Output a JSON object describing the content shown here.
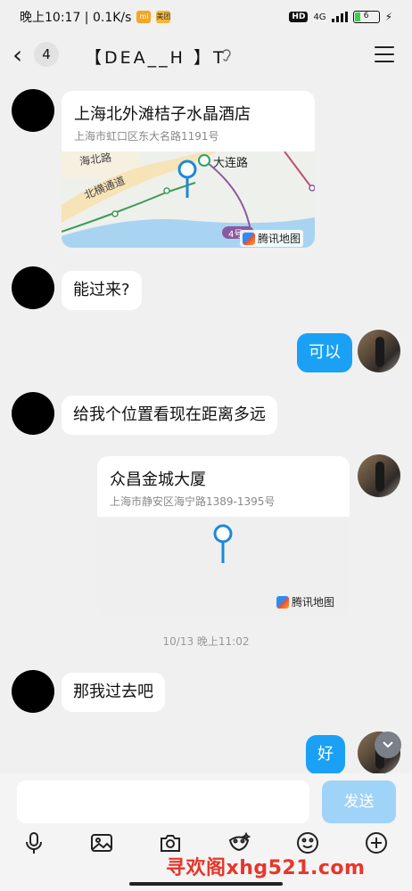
{
  "status_bar": {
    "time_speed": "晚上10:17 | 0.1K/s",
    "app_icon_1": "mi",
    "app_icon_2": "美团",
    "hd": "HD",
    "network": "4G",
    "battery": "6"
  },
  "header": {
    "back_count": "4",
    "title": "【DEA__H 】T",
    "ear_icon": "ear-icon",
    "menu_icon": "menu-icon"
  },
  "messages": [
    {
      "type": "location",
      "side": "left",
      "name": "上海北外滩桔子水晶酒店",
      "address": "上海市虹口区东大名路1191号",
      "map_labels": {
        "road_1": "海北路",
        "road_2": "北横通道",
        "metro": "大连路",
        "line": "4号",
        "brand": "腾讯地图"
      }
    },
    {
      "type": "text",
      "side": "left",
      "text": "能过来?"
    },
    {
      "type": "text",
      "side": "right",
      "text": "可以"
    },
    {
      "type": "text",
      "side": "left",
      "text": "给我个位置看现在距离多远"
    },
    {
      "type": "location",
      "side": "right",
      "name": "众昌金城大厦",
      "address": "上海市静安区海宁路1389-1395号",
      "brand": "腾讯地图"
    },
    {
      "type": "timestamp",
      "text": "10/13 晚上11:02"
    },
    {
      "type": "text",
      "side": "left",
      "text": "那我过去吧"
    },
    {
      "type": "text",
      "side": "right",
      "text": "好"
    }
  ],
  "composer": {
    "send_label": "发送",
    "tools": [
      "microphone-icon",
      "image-icon",
      "camera-icon",
      "sticker-icon",
      "emoji-icon",
      "plus-icon"
    ]
  },
  "watermark": "寻欢阁xhg521.com",
  "colors": {
    "accent": "#1aa1f5",
    "send_disabled": "#9fd3f7",
    "background": "#f0f0f0",
    "watermark": "#e8352a"
  }
}
